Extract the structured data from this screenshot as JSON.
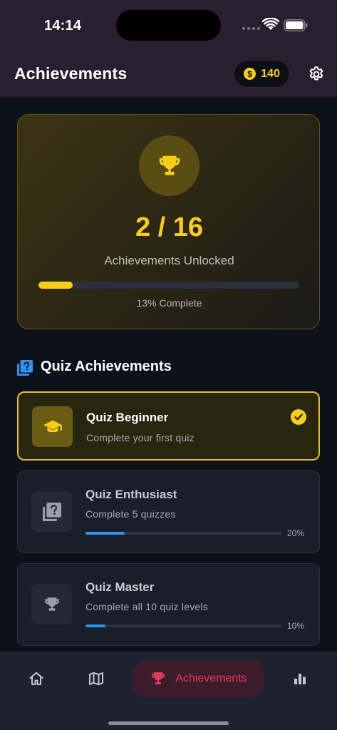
{
  "status_bar": {
    "time": "14:14"
  },
  "header": {
    "title": "Achievements",
    "coins": "140",
    "coin_symbol": "$"
  },
  "summary": {
    "count": "2 / 16",
    "label": "Achievements Unlocked",
    "progress_fraction": 0.13,
    "percent_text": "13% Complete"
  },
  "section": {
    "title": "Quiz Achievements"
  },
  "achievements": [
    {
      "title": "Quiz Beginner",
      "description": "Complete your first quiz",
      "unlocked": true,
      "icon": "graduation-cap-icon"
    },
    {
      "title": "Quiz Enthusiast",
      "description": "Complete 5 quizzes",
      "unlocked": false,
      "progress_fraction": 0.2,
      "percent_text": "20%",
      "icon": "quiz-question-icon"
    },
    {
      "title": "Quiz Master",
      "description": "Complete all 10 quiz levels",
      "unlocked": false,
      "progress_fraction": 0.1,
      "percent_text": "10%",
      "icon": "trophy-icon"
    }
  ],
  "nav": {
    "items": [
      {
        "id": "home",
        "icon": "home-icon"
      },
      {
        "id": "map",
        "icon": "map-icon"
      },
      {
        "id": "achievements",
        "label": "Achievements",
        "icon": "trophy-icon",
        "active": true
      },
      {
        "id": "stats",
        "icon": "bar-chart-icon"
      }
    ]
  },
  "colors": {
    "accent_gold": "#f8cf16",
    "progress_blue": "#2e95ef",
    "nav_active": "#e33a59",
    "background": "#0d111a",
    "header_bg": "#2a1f2f"
  }
}
